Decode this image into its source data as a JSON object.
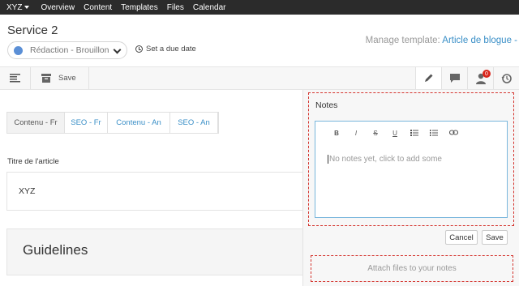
{
  "topnav": {
    "org": "XYZ",
    "links": [
      "Overview",
      "Content",
      "Templates",
      "Files",
      "Calendar"
    ]
  },
  "header": {
    "title": "Service 2",
    "status": "Rédaction - Brouillon",
    "status_color": "#5b8fd6",
    "due_date": "Set a due date",
    "manage_label": "Manage template:",
    "template_name": "Article de blogue -"
  },
  "toolbar": {
    "save_label": "Save",
    "notification_count": "0"
  },
  "tabs": [
    "Contenu - Fr",
    "SEO - Fr",
    "Contenu - An",
    "SEO - An"
  ],
  "content": {
    "field_label": "Titre de l'article",
    "field_value": "XYZ",
    "guidelines_title": "Guidelines"
  },
  "notes": {
    "title": "Notes",
    "editor_tools": [
      "B",
      "I",
      "S",
      "U",
      "ul",
      "ol",
      "link"
    ],
    "placeholder": "No notes yet, click to add some",
    "cancel_label": "Cancel",
    "save_label": "Save",
    "attach_label": "Attach files to your notes"
  }
}
